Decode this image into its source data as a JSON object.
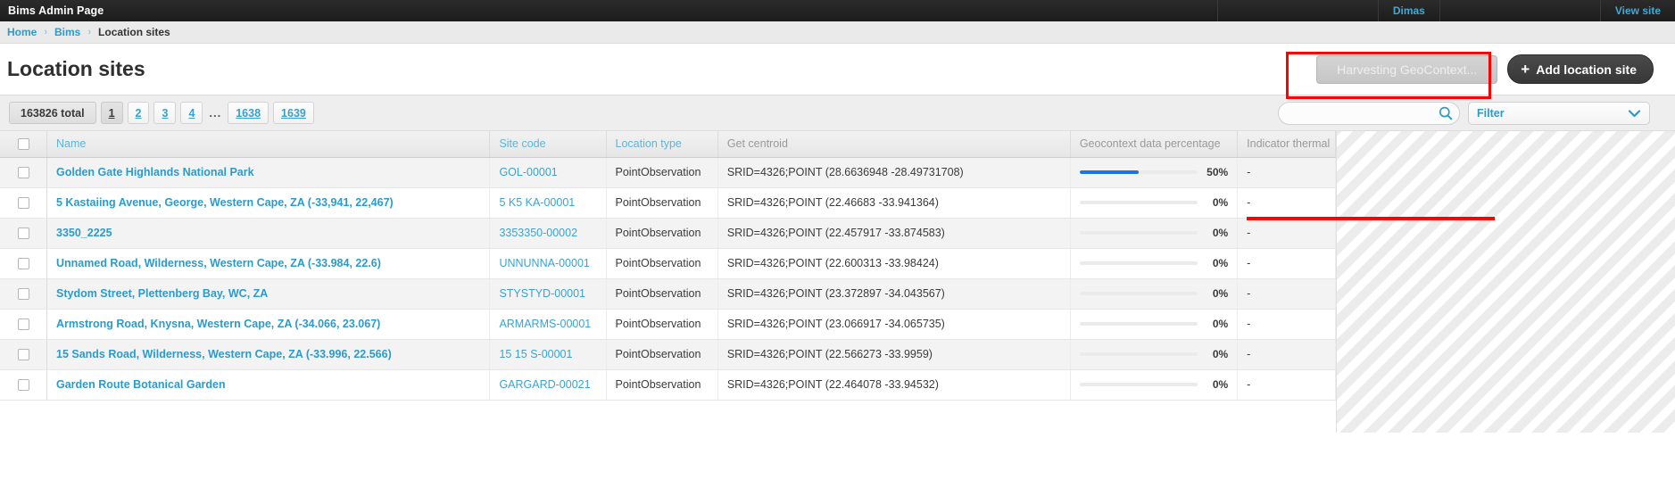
{
  "topbar": {
    "title": "Bims Admin Page",
    "user_link": "Dimas",
    "view_site_link": "View site"
  },
  "breadcrumb": {
    "home": "Home",
    "separator": "›",
    "section": "Bims",
    "current": "Location sites"
  },
  "page": {
    "title": "Location sites"
  },
  "actions": {
    "harvesting_label": "Harvesting GeoContext...",
    "harvesting_disabled": true,
    "add_label": "Add location site",
    "plus_icon": "+"
  },
  "pagination": {
    "total_label": "163826 total",
    "pages": [
      {
        "label": "1",
        "active": true
      },
      {
        "label": "2",
        "active": false
      },
      {
        "label": "3",
        "active": false
      },
      {
        "label": "4",
        "active": false
      }
    ],
    "ellipsis": "...",
    "tail_pages": [
      {
        "label": "1638",
        "active": false
      },
      {
        "label": "1639",
        "active": false
      }
    ]
  },
  "search": {
    "value": "",
    "placeholder": "",
    "icon": "search-icon"
  },
  "filter": {
    "label": "Filter",
    "icon": "chevron-down-icon"
  },
  "annotations": {
    "harvest_box_color": "#ff0000",
    "search_box_color": "#ff0000"
  },
  "table": {
    "columns": [
      {
        "key": "name",
        "label": "Name",
        "sortable": true
      },
      {
        "key": "site_code",
        "label": "Site code",
        "sortable": true
      },
      {
        "key": "location_type",
        "label": "Location type",
        "sortable": true
      },
      {
        "key": "centroid",
        "label": "Get centroid",
        "sortable": false
      },
      {
        "key": "percentage",
        "label": "Geocontext data percentage",
        "sortable": false
      },
      {
        "key": "indicator",
        "label": "Indicator thermal",
        "sortable": false
      }
    ],
    "rows": [
      {
        "name": "Golden Gate Highlands National Park",
        "site_code": "GOL-00001",
        "location_type": "PointObservation",
        "centroid": "SRID=4326;POINT (28.6636948 -28.49731708)",
        "percentage": 50,
        "percentage_label": "50%",
        "indicator": "-"
      },
      {
        "name": "5 Kastaiing Avenue, George, Western Cape, ZA (-33,941, 22,467)",
        "site_code": "5 K5 KA-00001",
        "location_type": "PointObservation",
        "centroid": "SRID=4326;POINT (22.46683 -33.941364)",
        "percentage": 0,
        "percentage_label": "0%",
        "indicator": "-"
      },
      {
        "name": "3350_2225",
        "site_code": "3353350-00002",
        "location_type": "PointObservation",
        "centroid": "SRID=4326;POINT (22.457917 -33.874583)",
        "percentage": 0,
        "percentage_label": "0%",
        "indicator": "-"
      },
      {
        "name": "Unnamed Road, Wilderness, Western Cape, ZA (-33.984, 22.6)",
        "site_code": "UNNUNNA-00001",
        "location_type": "PointObservation",
        "centroid": "SRID=4326;POINT (22.600313 -33.98424)",
        "percentage": 0,
        "percentage_label": "0%",
        "indicator": "-"
      },
      {
        "name": "Stydom Street, Plettenberg Bay, WC, ZA",
        "site_code": "STYSTYD-00001",
        "location_type": "PointObservation",
        "centroid": "SRID=4326;POINT (23.372897 -34.043567)",
        "percentage": 0,
        "percentage_label": "0%",
        "indicator": "-"
      },
      {
        "name": "Armstrong Road, Knysna, Western Cape, ZA (-34.066, 23.067)",
        "site_code": "ARMARMS-00001",
        "location_type": "PointObservation",
        "centroid": "SRID=4326;POINT (23.066917 -34.065735)",
        "percentage": 0,
        "percentage_label": "0%",
        "indicator": "-"
      },
      {
        "name": "15 Sands Road, Wilderness, Western Cape, ZA (-33.996, 22.566)",
        "site_code": "15 15 S-00001",
        "location_type": "PointObservation",
        "centroid": "SRID=4326;POINT (22.566273 -33.9959)",
        "percentage": 0,
        "percentage_label": "0%",
        "indicator": "-"
      },
      {
        "name": "Garden Route Botanical Garden",
        "site_code": "GARGARD-00021",
        "location_type": "PointObservation",
        "centroid": "SRID=4326;POINT (22.464078 -33.94532)",
        "percentage": 0,
        "percentage_label": "0%",
        "indicator": "-"
      }
    ]
  },
  "colors": {
    "link_blue": "#2c9bc9",
    "progress_blue": "#1a73e8",
    "header_dark": "#1c1c1c",
    "annotation_red": "#ff0000"
  }
}
